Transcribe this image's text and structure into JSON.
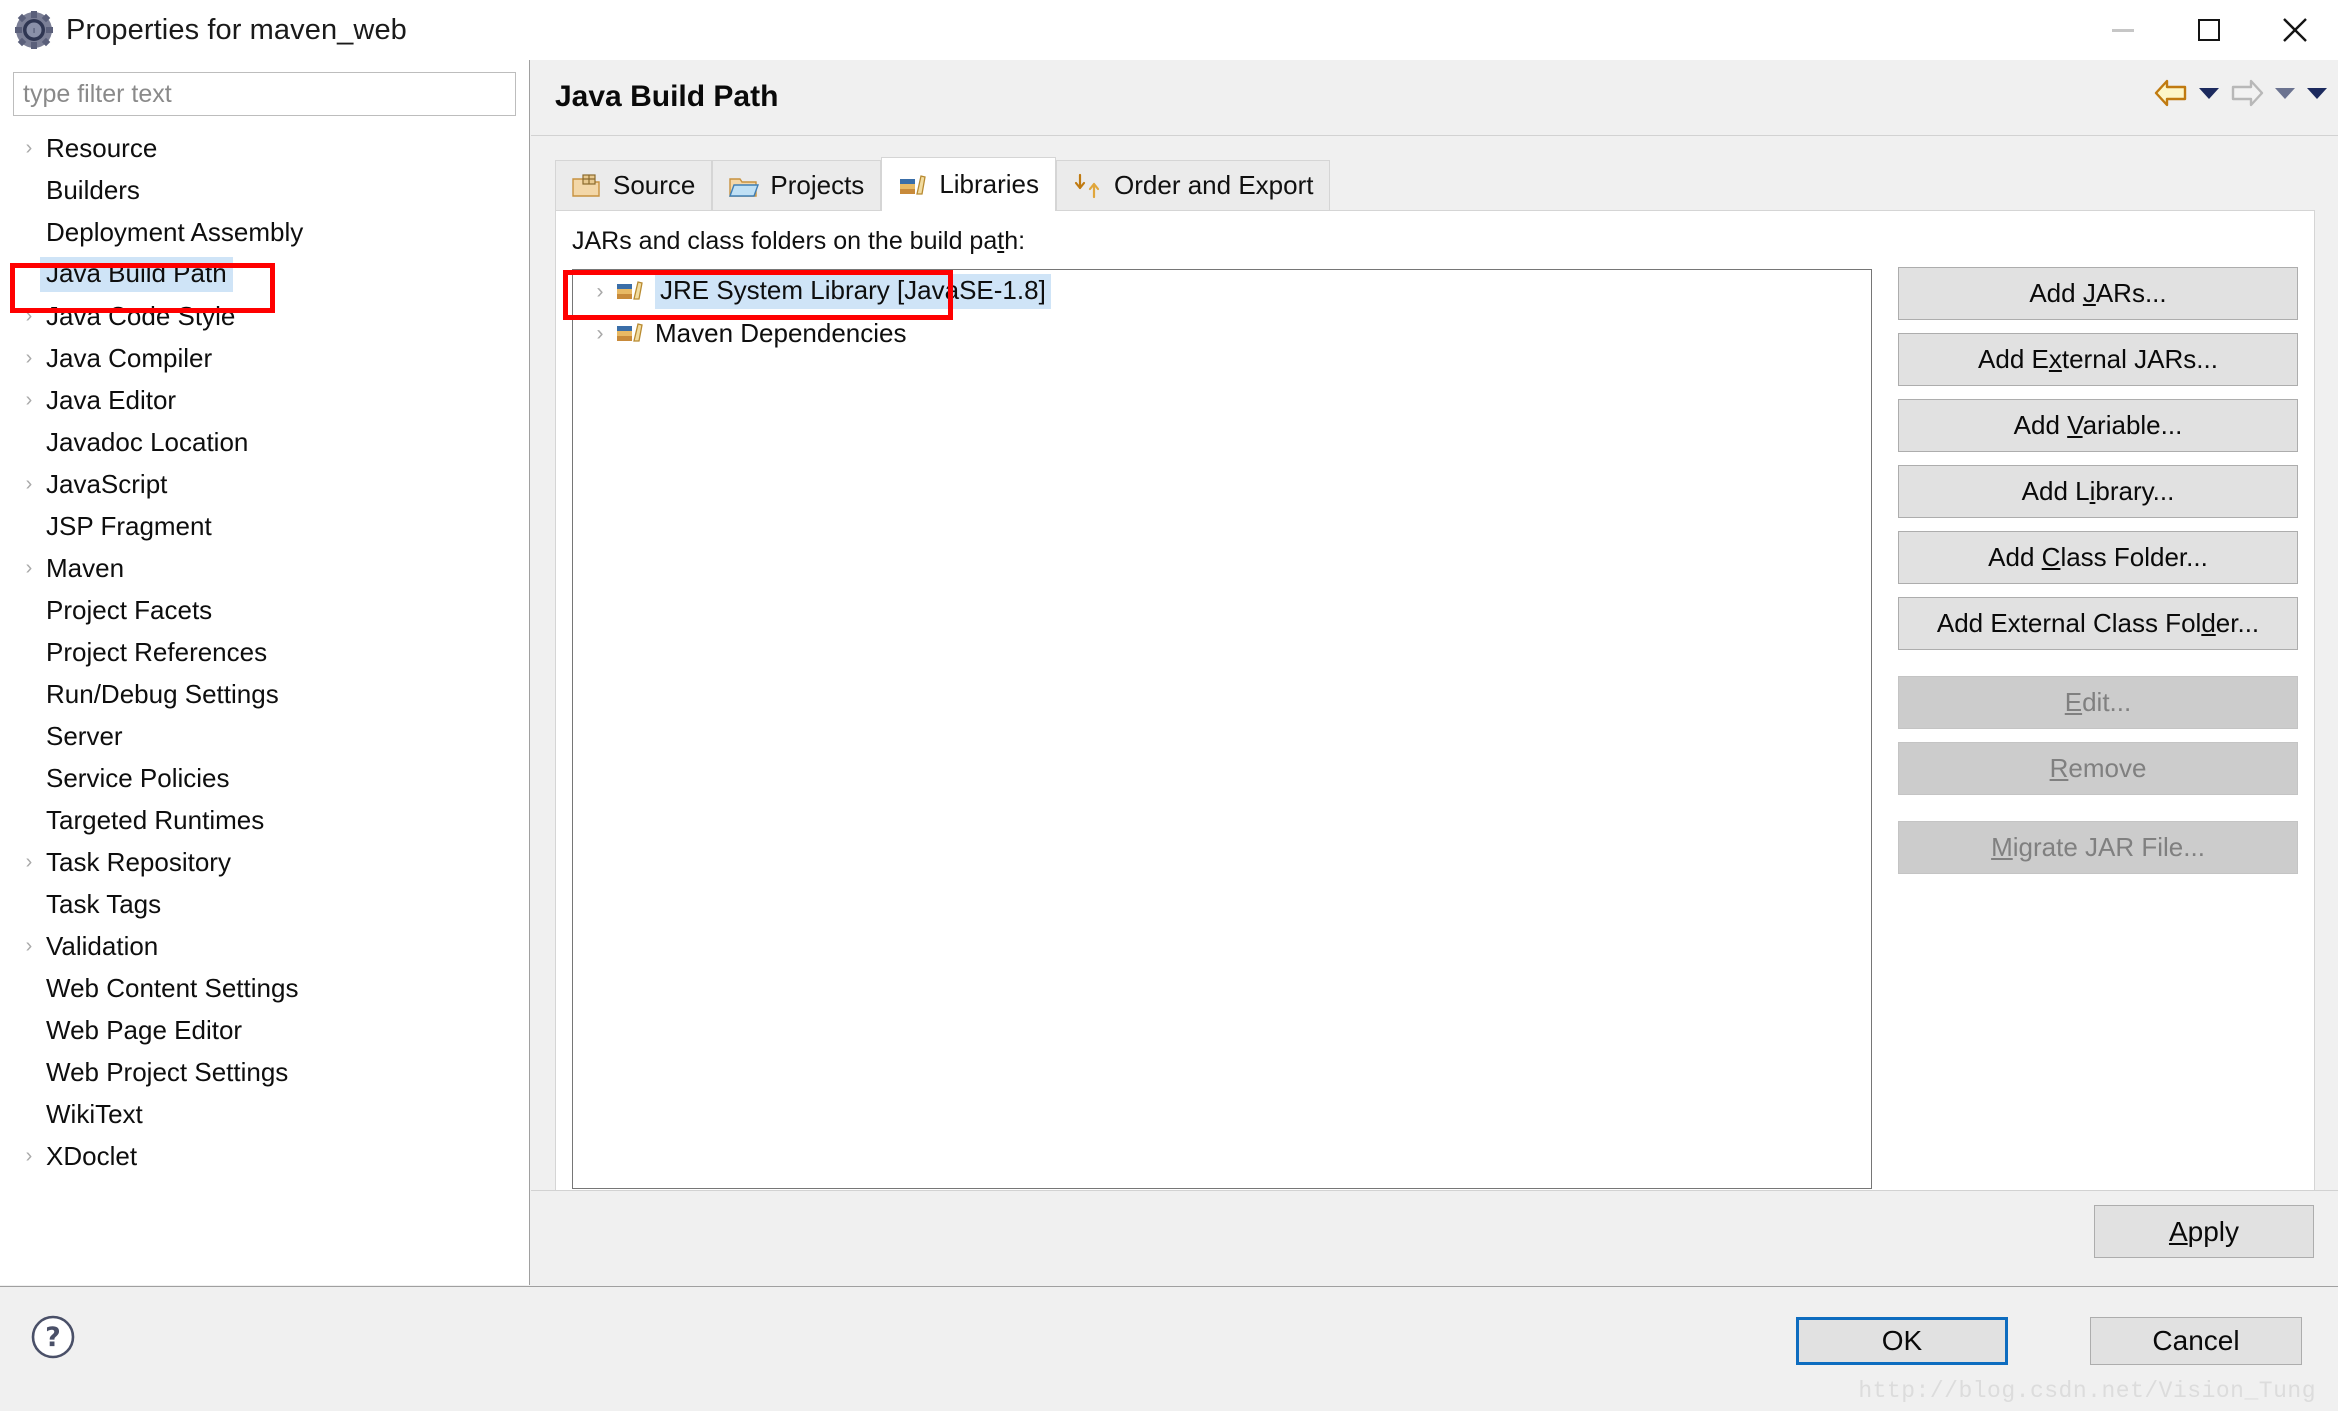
{
  "window": {
    "title": "Properties for maven_web",
    "icon": "eclipse-properties-icon",
    "minimize_label": "minimize-icon",
    "maximize_label": "maximize-icon",
    "close_label": "close-icon"
  },
  "sidebar": {
    "filter": {
      "value": "",
      "placeholder": "type filter text"
    },
    "items": [
      {
        "label": "Resource",
        "expandable": true,
        "selected": false
      },
      {
        "label": "Builders",
        "expandable": false,
        "selected": false
      },
      {
        "label": "Deployment Assembly",
        "expandable": false,
        "selected": false
      },
      {
        "label": "Java Build Path",
        "expandable": false,
        "selected": true
      },
      {
        "label": "Java Code Style",
        "expandable": true,
        "selected": false
      },
      {
        "label": "Java Compiler",
        "expandable": true,
        "selected": false
      },
      {
        "label": "Java Editor",
        "expandable": true,
        "selected": false
      },
      {
        "label": "Javadoc Location",
        "expandable": false,
        "selected": false
      },
      {
        "label": "JavaScript",
        "expandable": true,
        "selected": false
      },
      {
        "label": "JSP Fragment",
        "expandable": false,
        "selected": false
      },
      {
        "label": "Maven",
        "expandable": true,
        "selected": false
      },
      {
        "label": "Project Facets",
        "expandable": false,
        "selected": false
      },
      {
        "label": "Project References",
        "expandable": false,
        "selected": false
      },
      {
        "label": "Run/Debug Settings",
        "expandable": false,
        "selected": false
      },
      {
        "label": "Server",
        "expandable": false,
        "selected": false
      },
      {
        "label": "Service Policies",
        "expandable": false,
        "selected": false
      },
      {
        "label": "Targeted Runtimes",
        "expandable": false,
        "selected": false
      },
      {
        "label": "Task Repository",
        "expandable": true,
        "selected": false
      },
      {
        "label": "Task Tags",
        "expandable": false,
        "selected": false
      },
      {
        "label": "Validation",
        "expandable": true,
        "selected": false
      },
      {
        "label": "Web Content Settings",
        "expandable": false,
        "selected": false
      },
      {
        "label": "Web Page Editor",
        "expandable": false,
        "selected": false
      },
      {
        "label": "Web Project Settings",
        "expandable": false,
        "selected": false
      },
      {
        "label": "WikiText",
        "expandable": false,
        "selected": false
      },
      {
        "label": "XDoclet",
        "expandable": true,
        "selected": false
      }
    ]
  },
  "page": {
    "title": "Java Build Path",
    "nav": {
      "back_icon": "back-arrow-icon",
      "back_menu_icon": "chevron-down-icon",
      "forward_icon": "forward-arrow-icon",
      "forward_menu_icon": "chevron-down-icon",
      "view_menu_icon": "chevron-down-icon"
    }
  },
  "tabs": [
    {
      "label": "Source",
      "icon": "source-folder-icon",
      "active": false
    },
    {
      "label": "Projects",
      "icon": "projects-folder-icon",
      "active": false
    },
    {
      "label": "Libraries",
      "icon": "libraries-books-icon",
      "active": true
    },
    {
      "label": "Order and Export",
      "icon": "order-export-icon",
      "active": false
    }
  ],
  "libraries_tab": {
    "section_label_pre": "JARs and class folders on the build pa",
    "section_label_mnemonic": "t",
    "section_label_post": "h:",
    "entries": [
      {
        "label": "JRE System Library [JavaSE-1.8]",
        "icon": "library-icon",
        "expandable": true,
        "selected": true
      },
      {
        "label": "Maven Dependencies",
        "icon": "library-icon",
        "expandable": true,
        "selected": false
      }
    ],
    "buttons": [
      {
        "pre": "Add ",
        "mn": "J",
        "post": "ARs...",
        "enabled": true,
        "name": "add-jars-button"
      },
      {
        "pre": "Add E",
        "mn": "x",
        "post": "ternal JARs...",
        "enabled": true,
        "name": "add-external-jars-button"
      },
      {
        "pre": "Add ",
        "mn": "V",
        "post": "ariable...",
        "enabled": true,
        "name": "add-variable-button"
      },
      {
        "pre": "Add L",
        "mn": "i",
        "post": "brary...",
        "enabled": true,
        "name": "add-library-button"
      },
      {
        "pre": "Add ",
        "mn": "C",
        "post": "lass Folder...",
        "enabled": true,
        "name": "add-class-folder-button"
      },
      {
        "pre": "Add External Class Fol",
        "mn": "d",
        "post": "er...",
        "enabled": true,
        "name": "add-external-class-folder-button"
      },
      {
        "pre": "",
        "mn": "E",
        "post": "dit...",
        "enabled": false,
        "name": "edit-button",
        "gap": true
      },
      {
        "pre": "",
        "mn": "R",
        "post": "emove",
        "enabled": false,
        "name": "remove-button"
      },
      {
        "pre": "",
        "mn": "M",
        "post": "igrate JAR File...",
        "enabled": false,
        "name": "migrate-jar-file-button",
        "gap": true
      }
    ]
  },
  "footer": {
    "help_icon": "help-question-icon",
    "apply_mn": "A",
    "apply_post": "pply",
    "ok_label": "OK",
    "cancel_label": "Cancel",
    "watermark": "http://blog.csdn.net/Vision_Tung"
  },
  "annotations": {
    "sidebar_highlight": "Java Build Path",
    "list_highlight": "JRE System Library [JavaSE-1.8]"
  },
  "colors": {
    "selection_blue": "#cfe4f7",
    "annotation_red": "#ff0000",
    "focus_blue": "#0d6cbf",
    "dialog_gray": "#f0f0f0",
    "button_gray": "#e1e1e1"
  }
}
